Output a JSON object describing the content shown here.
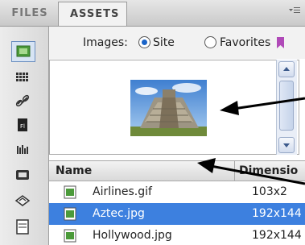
{
  "tabs": [
    {
      "label": "FILES",
      "active": false
    },
    {
      "label": "ASSETS",
      "active": true
    }
  ],
  "panel_menu_icon": "options-menu-icon",
  "toolbar": {
    "icons": [
      "images-icon",
      "colors-icon",
      "urls-icon",
      "flash-icon",
      "shockwave-icon",
      "movies-icon",
      "scripts-icon",
      "templates-icon"
    ],
    "selected": "images-icon"
  },
  "filter": {
    "label": "Images:",
    "options": [
      "Site",
      "Favorites"
    ],
    "selected": "Site"
  },
  "preview": {
    "image": "aztec-pyramid-thumbnail"
  },
  "list": {
    "columns": [
      "Name",
      "Dimensio"
    ],
    "rows": [
      {
        "name": "Airlines.gif",
        "dimensions": "103x2",
        "selected": false
      },
      {
        "name": "Aztec.jpg",
        "dimensions": "192x144",
        "selected": true
      },
      {
        "name": "Hollywood.jpg",
        "dimensions": "192x144",
        "selected": false
      }
    ]
  },
  "colors": {
    "selection": "#3d80df",
    "radio_dot": "#1a64c8",
    "favorites_icon": "#b04ab8"
  }
}
